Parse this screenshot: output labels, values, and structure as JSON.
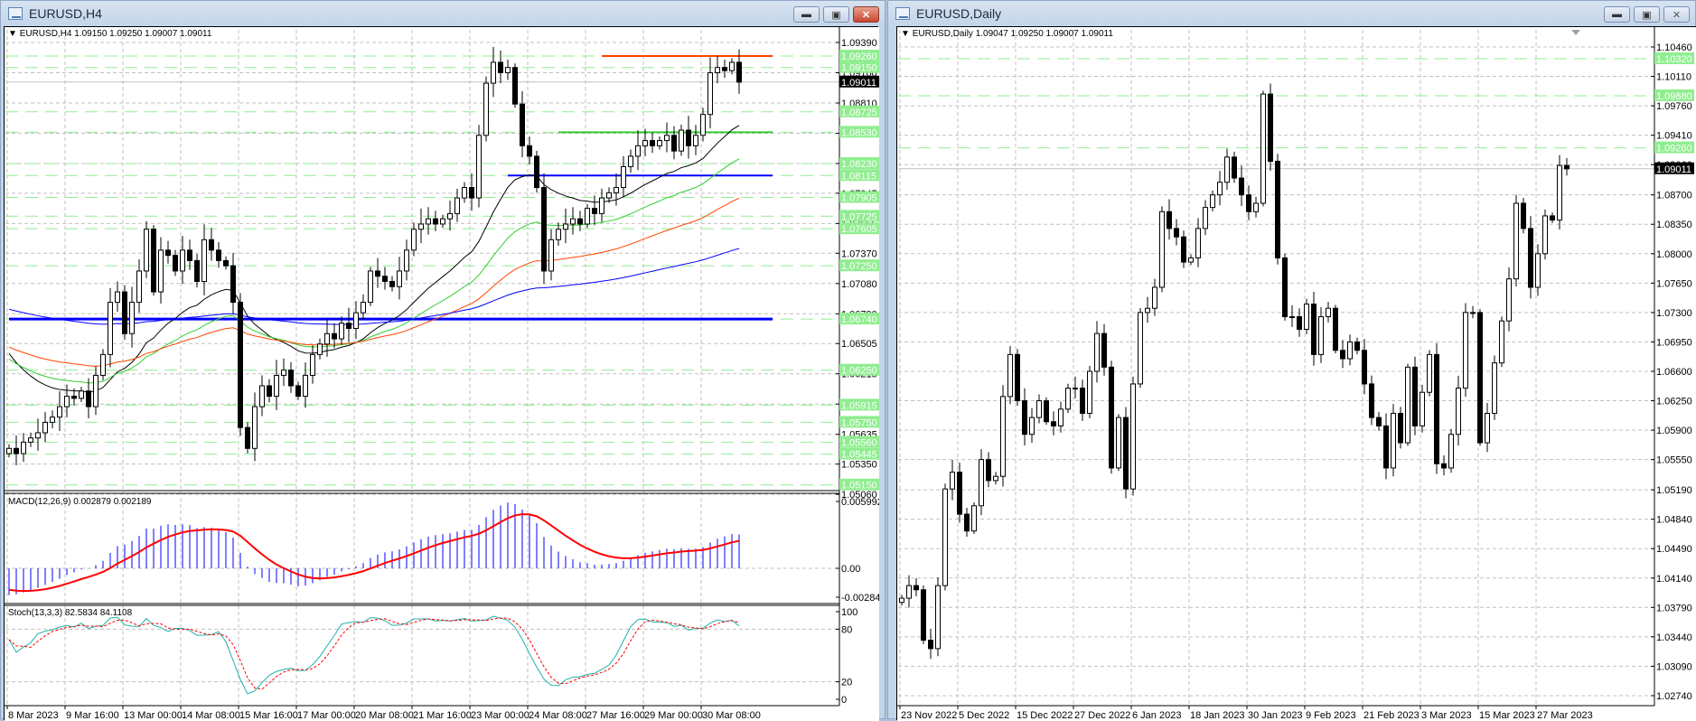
{
  "left_window": {
    "title": "EURUSD,H4",
    "info": "EURUSD,H4  1.09150 1.09250 1.09007 1.09011",
    "macd_label": "MACD(12,26,9) 0.002879 0.002189",
    "stoch_label": "Stoch(13,3,3) 82.5834 84.1108",
    "current_price": "1.09011",
    "price_ticks": [
      "1.09390",
      "1.09100",
      "1.08810",
      "1.08520",
      "1.08230",
      "1.07945",
      "1.07655",
      "1.07370",
      "1.07080",
      "1.06790",
      "1.06505",
      "1.06215",
      "1.05925",
      "1.05635",
      "1.05350",
      "1.05060"
    ],
    "level_labels": [
      "1.09260",
      "1.09150",
      "1.08725",
      "1.08530",
      "1.08230",
      "1.08115",
      "1.07905",
      "1.07725",
      "1.07605",
      "1.07250",
      "1.06740",
      "1.06250",
      "1.05915",
      "1.05750",
      "1.05560",
      "1.05445",
      "1.05150"
    ],
    "macd_ticks": [
      "0.005992",
      "0.00",
      "-0.002848"
    ],
    "stoch_ticks": [
      "100",
      "80",
      "20",
      "0"
    ],
    "time_labels": [
      "8 Mar 2023",
      "9 Mar 16:00",
      "13 Mar 00:00",
      "14 Mar 08:00",
      "15 Mar 16:00",
      "17 Mar 00:00",
      "20 Mar 08:00",
      "21 Mar 16:00",
      "23 Mar 00:00",
      "24 Mar 08:00",
      "27 Mar 16:00",
      "29 Mar 00:00",
      "30 Mar 08:00"
    ]
  },
  "right_window": {
    "title": "EURUSD,Daily",
    "info": "EURUSD,Daily  1.09047 1.09250 1.09007 1.09011",
    "current_price": "1.09011",
    "price_ticks": [
      "1.10460",
      "1.10110",
      "1.09760",
      "1.09410",
      "1.09060",
      "1.08700",
      "1.08350",
      "1.08000",
      "1.07650",
      "1.07300",
      "1.06950",
      "1.06600",
      "1.06250",
      "1.05900",
      "1.05550",
      "1.05190",
      "1.04840",
      "1.04490",
      "1.04140",
      "1.03790",
      "1.03440",
      "1.03090",
      "1.02740"
    ],
    "level_labels": [
      "1.10320",
      "1.09880",
      "1.09260"
    ],
    "time_labels": [
      "23 Nov 2022",
      "5 Dec 2022",
      "15 Dec 2022",
      "27 Dec 2022",
      "6 Jan 2023",
      "18 Jan 2023",
      "30 Jan 2023",
      "9 Feb 2023",
      "21 Feb 2023",
      "3 Mar 2023",
      "15 Mar 2023",
      "27 Mar 2023"
    ]
  },
  "buttons": {
    "minimize": "▬",
    "maximize": "▣",
    "close": "✕"
  },
  "colors": {
    "bull": "#ffffff",
    "bear": "#000000",
    "level": "#90ee90",
    "ma": [
      "#000000",
      "#32cd32",
      "#ff4500",
      "#0000ff"
    ],
    "macd_hist": "#0000ff",
    "macd_signal": "#ff0000",
    "stoch_main": "#20b2aa",
    "stoch_signal": "#ff0000"
  },
  "chart_data": [
    {
      "type": "candlestick",
      "symbol": "EURUSD",
      "timeframe": "H4",
      "ylim": [
        1.0506,
        1.0939
      ],
      "closes": [
        1.055,
        1.0545,
        1.0556,
        1.056,
        1.0565,
        1.0575,
        1.058,
        1.059,
        1.06,
        1.0598,
        1.0605,
        1.059,
        1.062,
        1.064,
        1.069,
        1.07,
        1.066,
        1.069,
        1.072,
        1.076,
        1.07,
        1.074,
        1.0735,
        1.072,
        1.074,
        1.073,
        1.071,
        1.075,
        1.074,
        1.073,
        1.0725,
        1.069,
        1.057,
        1.055,
        1.059,
        1.061,
        1.06,
        1.062,
        1.0625,
        1.061,
        1.06,
        1.062,
        1.064,
        1.065,
        1.066,
        1.0655,
        1.067,
        1.0665,
        1.068,
        1.069,
        1.072,
        1.0715,
        1.071,
        1.0705,
        1.072,
        1.074,
        1.076,
        1.0765,
        1.077,
        1.0765,
        1.077,
        1.0775,
        1.079,
        1.08,
        1.079,
        1.085,
        1.09,
        1.092,
        1.091,
        1.0915,
        1.088,
        1.084,
        1.083,
        1.08,
        1.072,
        1.075,
        1.076,
        1.0765,
        1.077,
        1.0765,
        1.078,
        1.0775,
        1.079,
        1.0795,
        1.08,
        1.082,
        1.083,
        1.084,
        1.0845,
        1.084,
        1.0845,
        1.085,
        1.0835,
        1.0855,
        1.084,
        1.085,
        1.087,
        1.091,
        1.0915,
        1.0912,
        1.092,
        1.0901
      ],
      "moving_averages": [
        {
          "period": 21,
          "seed": 1.065
        },
        {
          "period": 40,
          "seed": 1.064
        },
        {
          "period": 70,
          "seed": 1.065
        },
        {
          "period": 160,
          "seed": 1.0685
        }
      ],
      "levels": {
        "dashed": [
          1.0926,
          1.0915,
          1.08725,
          1.0853,
          1.0823,
          1.08115,
          1.07905,
          1.07725,
          1.07605,
          1.0725,
          1.0674,
          1.0625,
          1.05915,
          1.0575,
          1.0556,
          1.05445,
          1.0515
        ],
        "segments": [
          {
            "price": 1.0926,
            "from_bar": 82,
            "color": "#ff4500"
          },
          {
            "price": 1.0853,
            "from_bar": 76,
            "color": "#32cd32"
          },
          {
            "price": 1.08115,
            "from_bar": 69,
            "color": "#0000ff"
          },
          {
            "price": 1.0674,
            "from_bar": 0,
            "color": "#0000ff"
          }
        ]
      },
      "macd": {
        "fast": 12,
        "slow": 26,
        "signal": 9,
        "ylim": [
          -0.002848,
          0.005992
        ]
      },
      "stoch": {
        "k": 13,
        "d": 3,
        "slowing": 3,
        "ylim": [
          0,
          100
        ]
      }
    },
    {
      "type": "candlestick",
      "symbol": "EURUSD",
      "timeframe": "Daily",
      "ylim": [
        1.0274,
        1.1046
      ],
      "closes": [
        1.039,
        1.0405,
        1.04,
        1.034,
        1.033,
        1.0405,
        1.052,
        1.054,
        1.049,
        1.047,
        1.05,
        1.0555,
        1.053,
        1.0535,
        1.063,
        1.068,
        1.0625,
        1.0585,
        1.0605,
        1.0625,
        1.06,
        1.0595,
        1.0615,
        1.064,
        1.064,
        1.061,
        1.066,
        1.0705,
        1.0665,
        1.0545,
        1.0605,
        1.052,
        1.0645,
        1.073,
        1.0735,
        1.076,
        1.085,
        1.083,
        1.082,
        1.079,
        1.0795,
        1.083,
        1.0855,
        1.087,
        1.0885,
        1.0915,
        1.089,
        1.087,
        1.085,
        1.086,
        1.099,
        1.091,
        1.0795,
        1.0725,
        1.0725,
        1.071,
        1.074,
        1.068,
        1.0725,
        1.0735,
        1.0685,
        1.0675,
        1.0695,
        1.0685,
        1.0645,
        1.0605,
        1.0595,
        1.0545,
        1.061,
        1.0575,
        1.0665,
        1.0595,
        1.0635,
        1.068,
        1.055,
        1.0545,
        1.0585,
        1.064,
        1.073,
        1.073,
        1.0575,
        1.061,
        1.067,
        1.072,
        1.077,
        1.086,
        1.083,
        1.076,
        1.08,
        1.0845,
        1.084,
        1.0905,
        1.0901
      ],
      "levels": {
        "dashed": [
          1.1032,
          1.0988,
          1.0926
        ]
      }
    }
  ]
}
